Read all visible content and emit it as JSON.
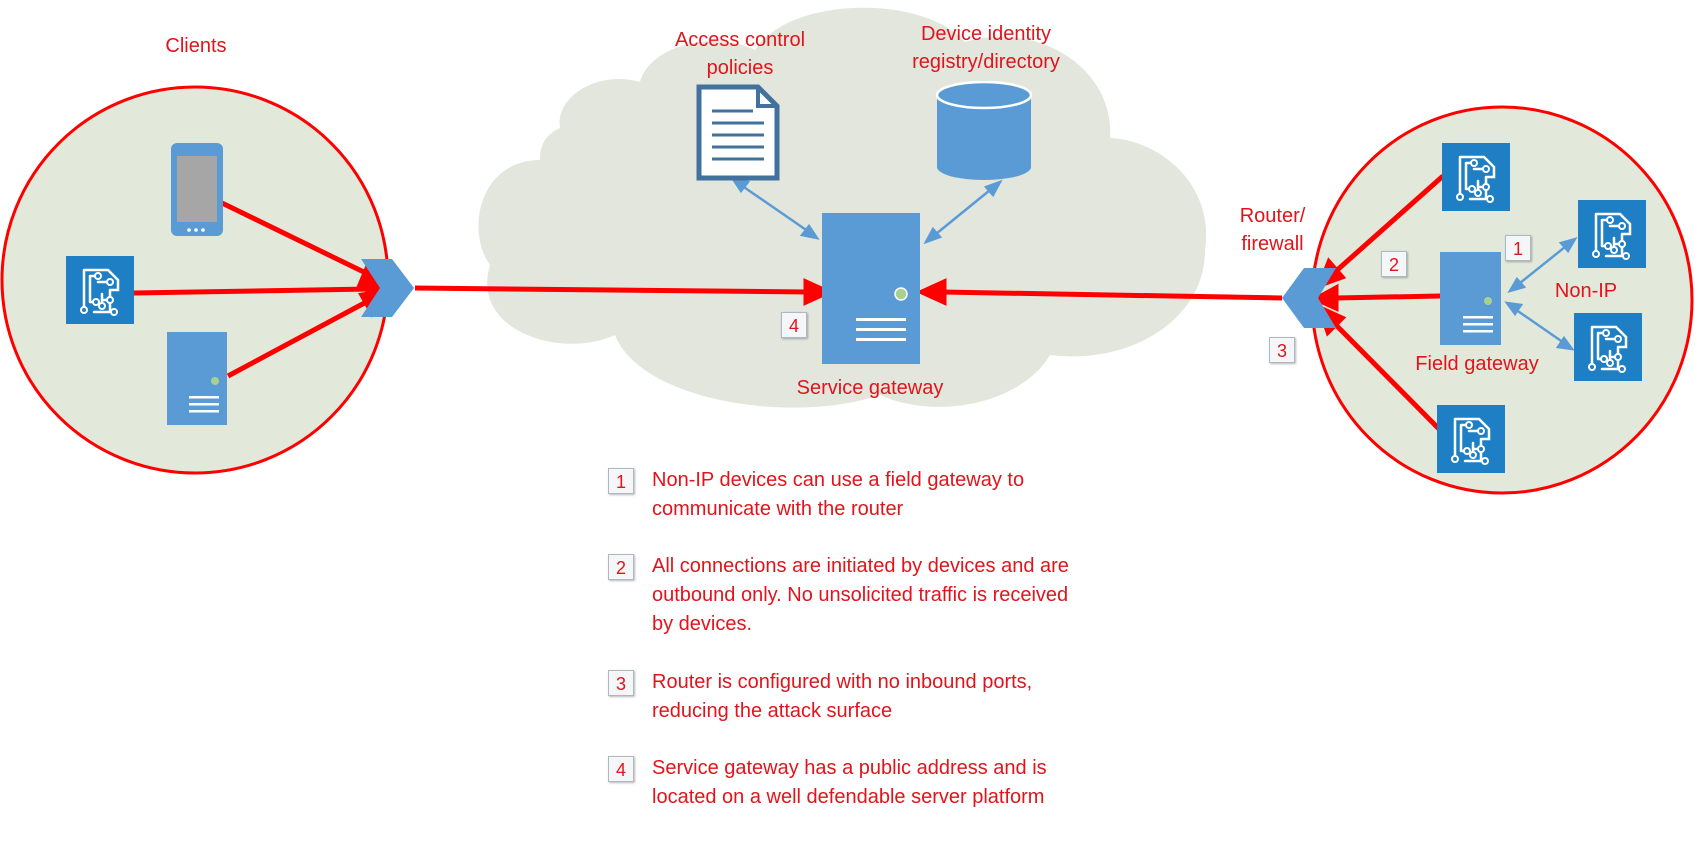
{
  "labels": {
    "clients": "Clients",
    "access_control": "Access control policies",
    "device_identity": "Device identity registry/directory",
    "service_gateway": "Service gateway",
    "router_firewall": "Router/ firewall",
    "non_ip": "Non-IP",
    "field_gateway": "Field gateway"
  },
  "badges": {
    "b1": "1",
    "b2": "2",
    "b3": "3",
    "b4": "4"
  },
  "notes": [
    {
      "num": "1",
      "text": "Non-IP devices can use a field gateway to communicate with the router"
    },
    {
      "num": "2",
      "text": "All connections are initiated by devices and are outbound only. No unsolicited traffic is received by devices."
    },
    {
      "num": "3",
      "text": "Router is configured with no inbound ports, reducing the attack surface"
    },
    {
      "num": "4",
      "text": "Service gateway has a public address and is located on a well defendable server platform"
    }
  ],
  "colors": {
    "accent_red": "#e2141b",
    "device_blue": "#1f7fc4",
    "server_blue": "#5b9bd5",
    "cloud_fill": "#e3e6dc",
    "zone_fill": "#e3e9da"
  },
  "icons": [
    "smartphone-icon",
    "iot-chip-icon",
    "server-icon",
    "document-icon",
    "database-icon",
    "router-icon"
  ]
}
